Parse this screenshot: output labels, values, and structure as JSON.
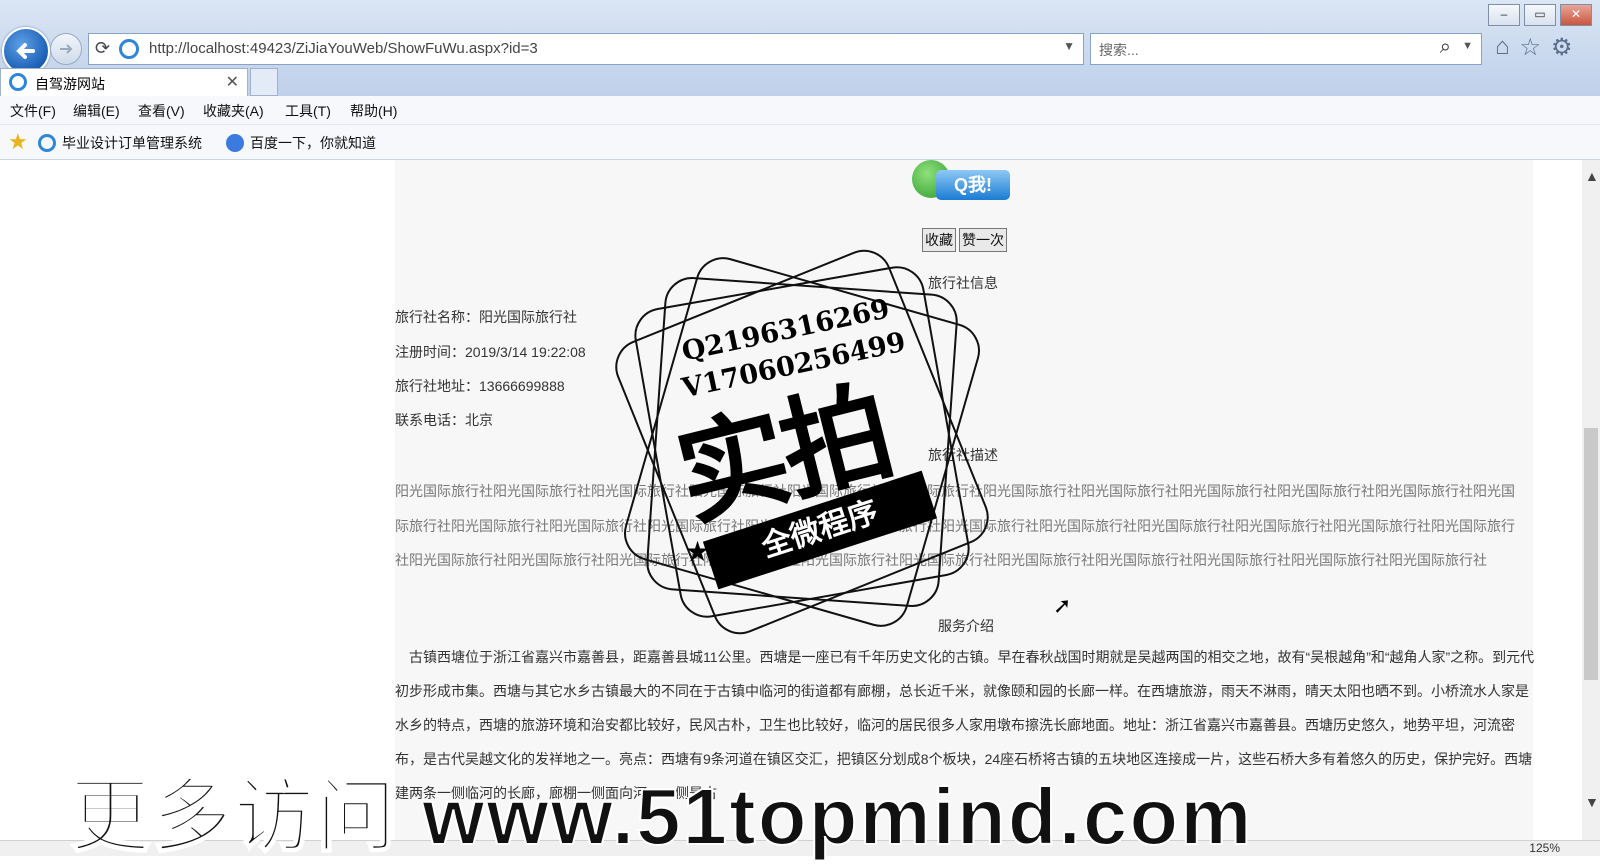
{
  "window": {
    "minimize": "–",
    "restore": "▭",
    "close": "✕"
  },
  "address_bar": {
    "url": "http://localhost:49423/ZiJiaYouWeb/ShowFuWu.aspx?id=3"
  },
  "search": {
    "placeholder": "搜索..."
  },
  "tab": {
    "title": "自驾游网站"
  },
  "menu": [
    "文件(F)",
    "编辑(E)",
    "查看(V)",
    "收藏夹(A)",
    "工具(T)",
    "帮助(H)"
  ],
  "favorites": [
    {
      "label": "毕业设计订单管理系统",
      "icon": "ie-icon"
    },
    {
      "label": "百度一下，你就知道",
      "icon": "baidu-paw-icon"
    }
  ],
  "page": {
    "qq_button": "Q我!",
    "buttons": {
      "favorite": "收藏",
      "like": "赞一次"
    },
    "agency_heading": "旅行社信息",
    "agency": {
      "name": "旅行社名称：阳光国际旅行社",
      "registered": "注册时间：2019/3/14 19:22:08",
      "address": "旅行社地址：13666699888",
      "phone": "联系电话：北京"
    },
    "desc_heading": "旅行社描述",
    "desc_text": "阳光国际旅行社阳光国际旅行社阳光国际旅行社阳光国际旅行社阳光国际旅行社阳光国际旅行社阳光国际旅行社阳光国际旅行社阳光国际旅行社阳光国际旅行社阳光国际旅行社阳光国际旅行社阳光国际旅行社阳光国际旅行社阳光国际旅行社阳光国际旅行社阳光国际旅行社阳光国际旅行社阳光国际旅行社阳光国际旅行社阳光国际旅行社阳光国际旅行社阳光国际旅行社阳光国际旅行社阳光国际旅行社阳光国际旅行社阳光国际旅行社阳光国际旅行社阳光国际旅行社阳光国际旅行社阳光国际旅行社阳光国际旅行社阳光国际旅行社阳光国际旅行社",
    "service_heading": "服务介绍",
    "service_text": "古镇西塘位于浙江省嘉兴市嘉善县，距嘉善县城11公里。西塘是一座已有千年历史文化的古镇。早在春秋战国时期就是吴越两国的相交之地，故有“吴根越角”和“越角人家”之称。到元代初步形成市集。西塘与其它水乡古镇最大的不同在于古镇中临河的街道都有廊棚，总长近千米，就像颐和园的长廊一样。在西塘旅游，雨天不淋雨，晴天太阳也晒不到。小桥流水人家是水乡的特点，西塘的旅游环境和治安都比较好，民风古朴，卫生也比较好，临河的居民很多人家用墩布擦洗长廊地面。地址：浙江省嘉兴市嘉善县。西塘历史悠久，地势平坦，河流密布，是古代吴越文化的发祥地之一。亮点：西塘有9条河道在镇区交汇，把镇区分划成8个板块，24座石桥将古镇的五块地区连接成一片，这些石桥大多有着悠久的历史，保护完好。西塘建两条一侧临河的长廊，廊棚一侧面向河，一侧是古"
  },
  "watermark": {
    "contact_q": "Q2196316269",
    "contact_v": "V17060256499",
    "big": "实拍",
    "ribbon": "全微程序",
    "bottom": "更多访问 www.51topmind.com"
  },
  "status": {
    "zoom": "125%"
  }
}
